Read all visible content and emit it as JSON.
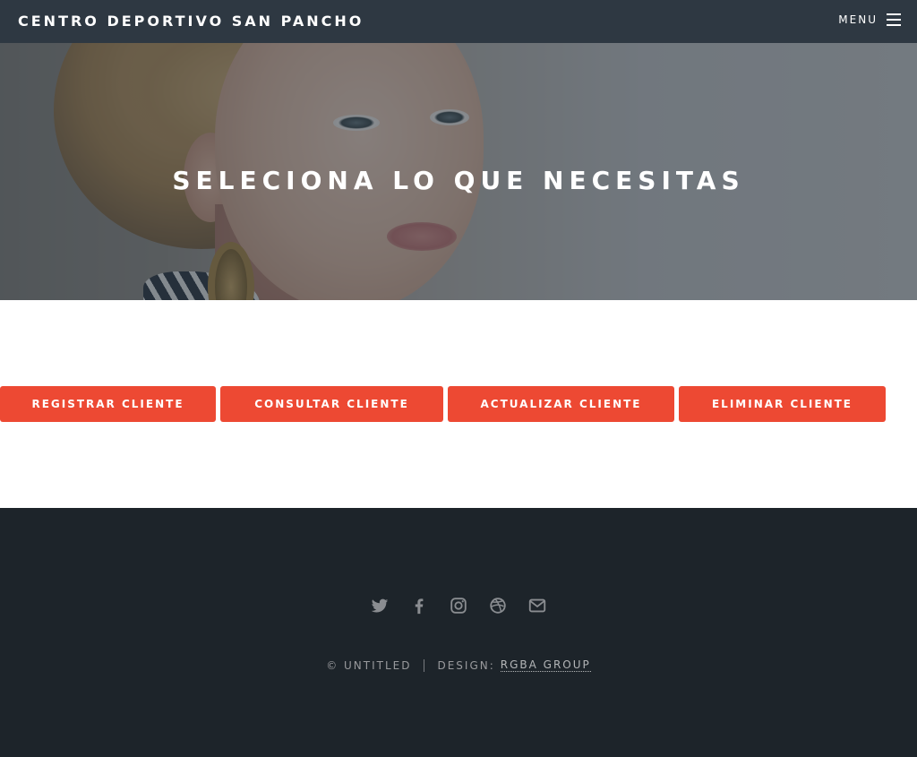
{
  "header": {
    "site_title": "CENTRO DEPORTIVO SAN PANCHO",
    "menu_label": "MENU"
  },
  "banner": {
    "title": "SELECIONA LO QUE NECESITAS"
  },
  "actions": [
    {
      "label": "REGISTRAR CLIENTE"
    },
    {
      "label": "CONSULTAR CLIENTE"
    },
    {
      "label": "ACTUALIZAR CLIENTE"
    },
    {
      "label": "ELIMINAR CLIENTE"
    }
  ],
  "footer": {
    "social_icons": [
      "twitter-icon",
      "facebook-icon",
      "instagram-icon",
      "dribbble-icon",
      "envelope-icon"
    ],
    "copyright": "© UNTITLED",
    "design_prefix": "DESIGN:",
    "design_link": "RGBA GROUP"
  },
  "colors": {
    "header_bg": "#2e3842",
    "button_bg": "#ed4933",
    "footer_bg": "#1d242a",
    "footer_text": "#999a9d"
  }
}
